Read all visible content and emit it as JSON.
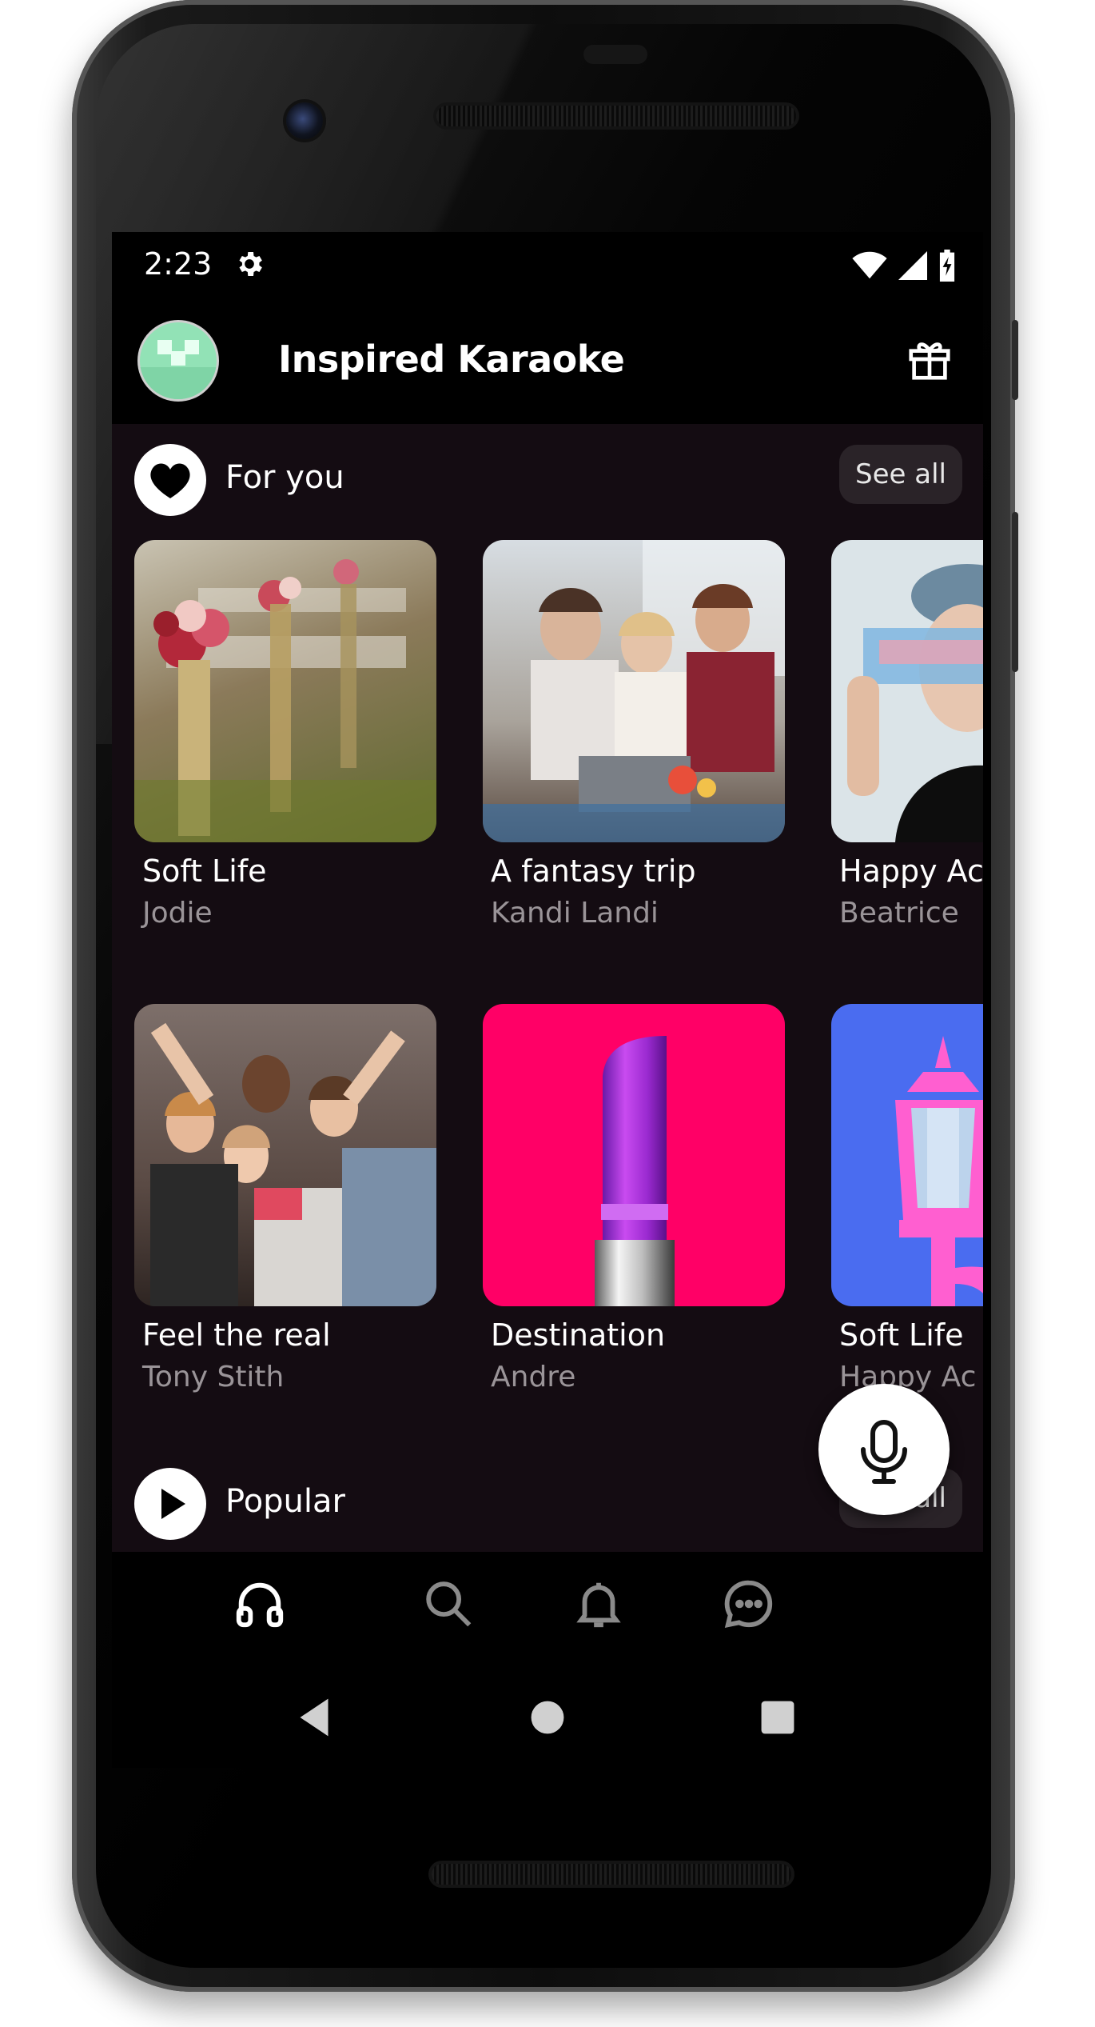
{
  "status_bar": {
    "time": "2:23"
  },
  "app_bar": {
    "title": "Inspired Karaoke"
  },
  "sections": [
    {
      "title": "For you",
      "see_all_label": "See all"
    },
    {
      "title": "Popular",
      "see_all_label": "See all"
    }
  ],
  "cards_row1": [
    {
      "title": "Soft Life",
      "artist": "Jodie"
    },
    {
      "title": "A fantasy trip",
      "artist": "Kandi Landi"
    },
    {
      "title": "Happy Ac",
      "artist": "Beatrice"
    }
  ],
  "cards_row2": [
    {
      "title": "Feel the real",
      "artist": "Tony Stith"
    },
    {
      "title": "Destination",
      "artist": "Andre"
    },
    {
      "title": "Soft Life",
      "artist": "Happy Ac"
    }
  ],
  "colors": {
    "content_bg": "#140c12",
    "avatar_bg": "#92e2b6",
    "destination_art": "#ff0066",
    "soft_life_art": "#4a6cf0",
    "pink_accent": "#ff5fd0"
  },
  "icons": {
    "status": [
      "gear-icon",
      "wifi-icon",
      "signal-icon",
      "battery-icon"
    ],
    "app_bar": [
      "avatar",
      "gift-icon"
    ],
    "sections": [
      "heart-icon",
      "play-icon"
    ],
    "fab": "microphone-icon",
    "bottom_nav": [
      "headphones-icon",
      "search-icon",
      "bell-icon",
      "chat-icon"
    ],
    "system_nav": [
      "back-icon",
      "home-icon",
      "recents-icon"
    ]
  }
}
